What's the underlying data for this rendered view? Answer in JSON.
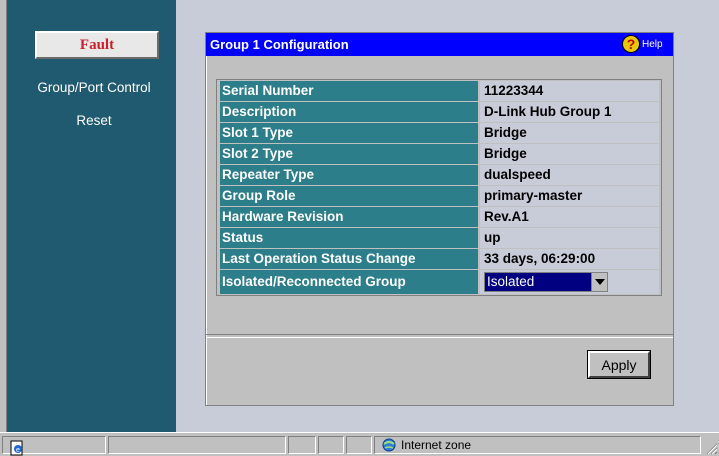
{
  "sidebar": {
    "fault_label": "Fault",
    "links": [
      "Group/Port Control",
      "Reset"
    ]
  },
  "panel": {
    "title": "Group 1 Configuration",
    "help_label": "Help",
    "rows": [
      {
        "label": "Serial Number",
        "value": "11223344"
      },
      {
        "label": "Description",
        "value": "D-Link Hub Group 1"
      },
      {
        "label": "Slot 1 Type",
        "value": "Bridge"
      },
      {
        "label": "Slot 2 Type",
        "value": "Bridge"
      },
      {
        "label": "Repeater Type",
        "value": "dualspeed"
      },
      {
        "label": "Group Role",
        "value": "primary-master"
      },
      {
        "label": "Hardware Revision",
        "value": "Rev.A1"
      },
      {
        "label": "Status",
        "value": "up"
      },
      {
        "label": "Last Operation Status Change",
        "value": "33 days, 06:29:00"
      }
    ],
    "select_row": {
      "label": "Isolated/Reconnected Group",
      "selected": "Isolated"
    },
    "apply_label": "Apply"
  },
  "statusbar": {
    "zone_text": "Internet zone"
  },
  "colors": {
    "sidebar_bg": "#1f5a70",
    "title_bg": "#0000ff",
    "label_bg": "#2b7e8a",
    "fault_text": "#cc1f2b"
  }
}
